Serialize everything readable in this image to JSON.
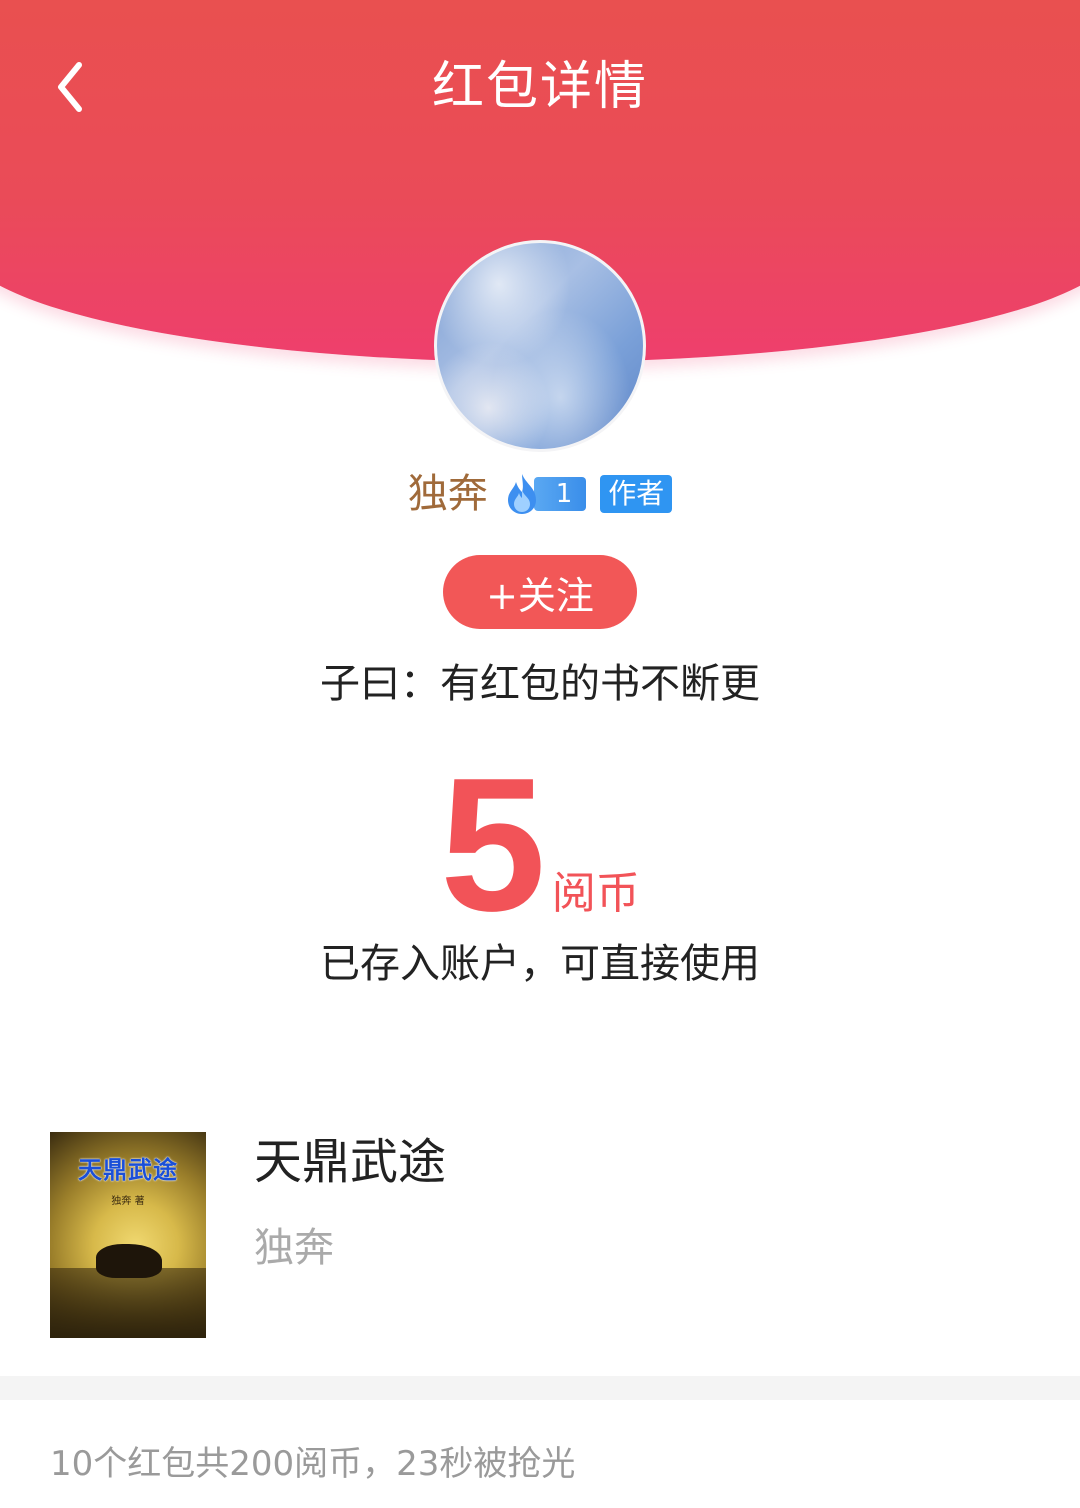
{
  "header": {
    "title": "红包详情",
    "back_icon": "chevron-left-icon",
    "bg_color": "#e9504f"
  },
  "sender": {
    "name": "独奔",
    "level": "1",
    "level_icon": "flame-icon",
    "role_tag": "作者",
    "follow_label": "+关注",
    "motto": "子曰：有红包的书不断更"
  },
  "reward": {
    "amount": "5",
    "unit": "阅币",
    "note": "已存入账户，可直接使用",
    "color": "#f25358"
  },
  "book": {
    "title": "天鼎武途",
    "author": "独奔",
    "cover_title": "天鼎武途",
    "cover_author": "独奔 著"
  },
  "summary": "10个红包共200阅币，23秒被抢光"
}
